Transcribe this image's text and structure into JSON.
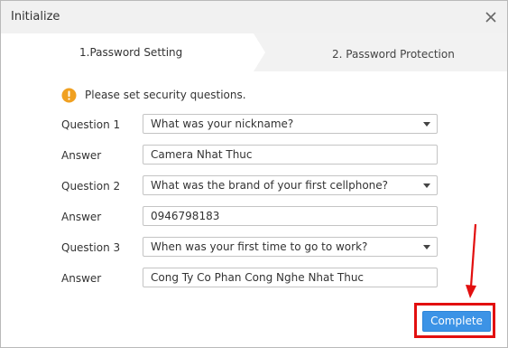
{
  "dialog": {
    "title": "Initialize",
    "close_icon": "close-icon"
  },
  "steps": [
    {
      "label": "1.Password Setting",
      "active": true
    },
    {
      "label": "2. Password Protection",
      "active": false
    }
  ],
  "notice": {
    "icon": "warning-icon",
    "icon_color": "#f0a020",
    "text": "Please set security questions."
  },
  "questions": [
    {
      "question_label": "Question 1",
      "question_value": "What was your nickname?",
      "answer_label": "Answer",
      "answer_value": "Camera Nhat Thuc"
    },
    {
      "question_label": "Question 2",
      "question_value": "What was the brand of your first cellphone?",
      "answer_label": "Answer",
      "answer_value": "0946798183"
    },
    {
      "question_label": "Question 3",
      "question_value": "When was your first time to go to work?",
      "answer_label": "Answer",
      "answer_value": "Cong Ty Co Phan Cong Nghe Nhat Thuc"
    }
  ],
  "actions": {
    "complete_label": "Complete",
    "complete_color": "#3c93e6"
  },
  "annotation": {
    "color": "#e20f0f"
  }
}
